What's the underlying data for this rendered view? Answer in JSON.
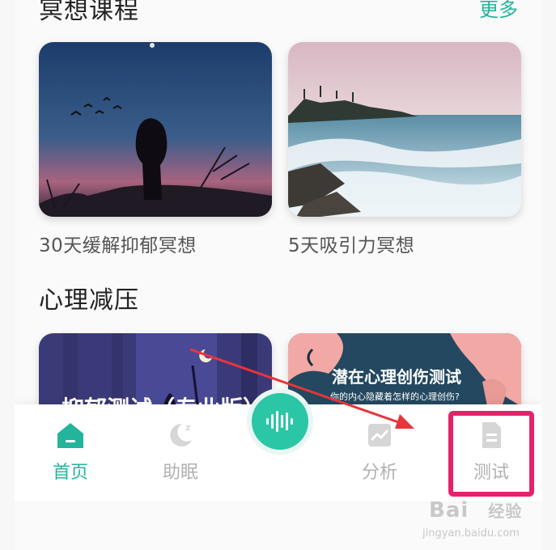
{
  "meditation": {
    "title": "冥想课程",
    "more_label": "更多"
  },
  "courses": [
    {
      "caption": "30天缓解抑郁冥想",
      "image": "night-silhouette-girl"
    },
    {
      "caption": "5天吸引力冥想",
      "image": "ocean-waves-beach"
    }
  ],
  "stress": {
    "title": "心理减压"
  },
  "stress_cards": [
    {
      "title": "抑郁测试（专业版）",
      "image": "night-moon-purple"
    },
    {
      "title": "潜在心理创伤测试",
      "subtitle": "你的内心隐藏着怎样的心理创伤?",
      "image": "pink-silhouette"
    }
  ],
  "nav": {
    "items": [
      {
        "label": "首页",
        "icon": "home-icon",
        "active": true
      },
      {
        "label": "助眠",
        "icon": "moon-sleep-icon",
        "active": false
      },
      {
        "label": "",
        "icon": "audio-wave-icon",
        "center": true
      },
      {
        "label": "分析",
        "icon": "chart-icon",
        "active": false
      },
      {
        "label": "测试",
        "icon": "document-icon",
        "active": false
      }
    ]
  },
  "colors": {
    "accent": "#23b59b",
    "highlight": "#e5236b",
    "arrow": "#e8343a"
  },
  "watermark": {
    "brand": "Bai",
    "brand_cn": "经验",
    "url": "jingyan.baidu.com"
  }
}
